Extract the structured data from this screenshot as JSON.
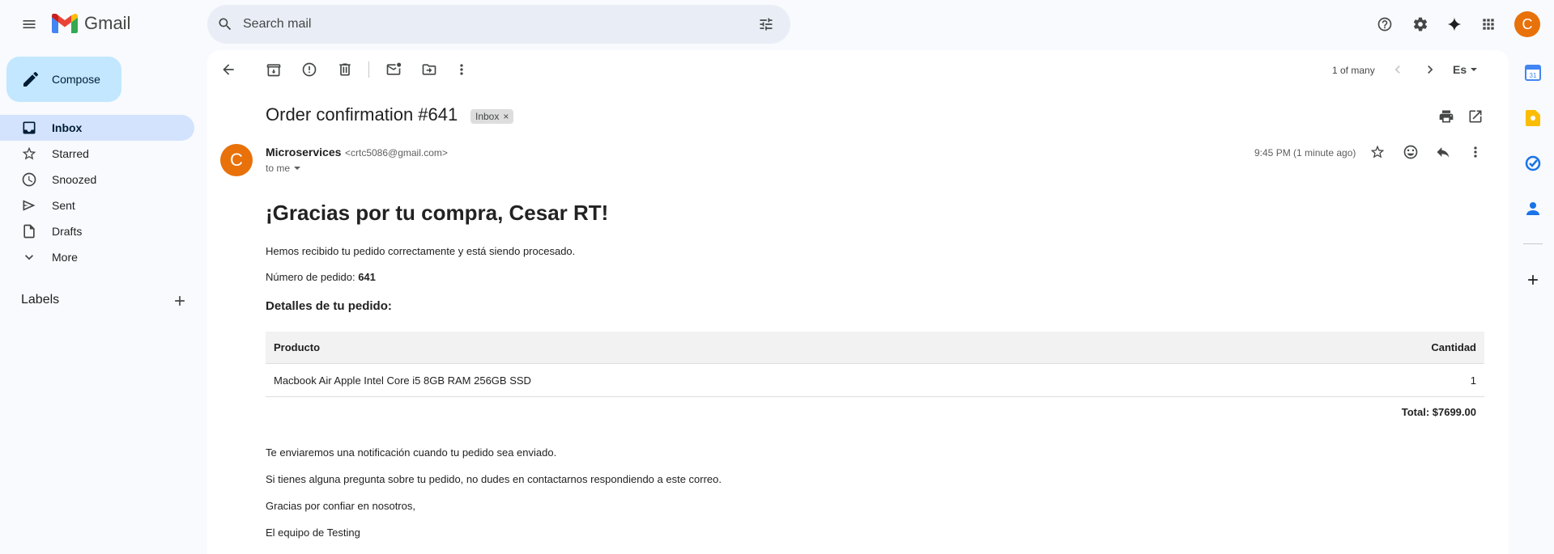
{
  "app": {
    "name": "Gmail",
    "brand_color": "#ea4335"
  },
  "search": {
    "placeholder": "Search mail"
  },
  "account": {
    "initial": "C",
    "color": "#e8710a"
  },
  "sidebar": {
    "compose_label": "Compose",
    "items": [
      {
        "label": "Inbox",
        "icon": "inbox-icon",
        "active": true
      },
      {
        "label": "Starred",
        "icon": "star-icon"
      },
      {
        "label": "Snoozed",
        "icon": "clock-icon"
      },
      {
        "label": "Sent",
        "icon": "send-icon"
      },
      {
        "label": "Drafts",
        "icon": "draft-icon"
      },
      {
        "label": "More",
        "icon": "chevron-down-icon"
      }
    ],
    "labels_heading": "Labels"
  },
  "toolbar": {
    "pagination": "1 of many",
    "language": "Es"
  },
  "email": {
    "subject": "Order confirmation #641",
    "label_chip": "Inbox",
    "sender_name": "Microservices",
    "sender_email": "<crtc5086@gmail.com>",
    "sender_initial": "C",
    "recipient": "to me",
    "time": "9:45 PM (1 minute ago)"
  },
  "content": {
    "heading": "¡Gracias por tu compra, Cesar RT!",
    "intro": "Hemos recibido tu pedido correctamente y está siendo procesado.",
    "order_label": "Número de pedido: ",
    "order_number": "641",
    "details_heading": "Detalles de tu pedido:",
    "table": {
      "headers": [
        "Producto",
        "Cantidad"
      ],
      "rows": [
        [
          "Macbook Air Apple Intel Core i5 8GB RAM 256GB SSD",
          "1"
        ]
      ]
    },
    "total": "Total: $7699.00",
    "footer": [
      "Te enviaremos una notificación cuando tu pedido sea enviado.",
      "Si tienes alguna pregunta sobre tu pedido, no dudes en contactarnos respondiendo a este correo.",
      "Gracias por confiar en nosotros,",
      "El equipo de Testing"
    ]
  }
}
